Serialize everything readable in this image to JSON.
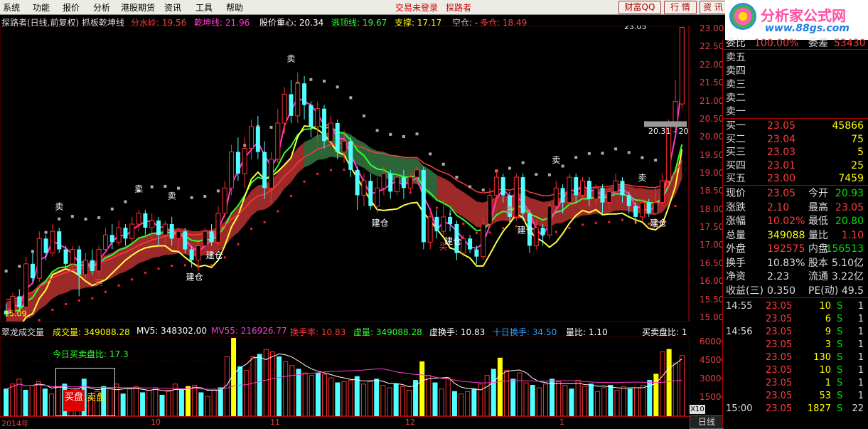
{
  "menu": [
    "系统",
    "功能",
    "报价",
    "分析",
    "港股期货",
    "资讯",
    "工具",
    "帮助"
  ],
  "menu_status": [
    "交易未登录",
    "探路者"
  ],
  "top_buttons": [
    "财富QQ",
    "行 情",
    "资 讯"
  ],
  "logo": {
    "title": "分析家公式网",
    "url": "www.88gs.com"
  },
  "main_indicator": {
    "name": "探路者(日线,前复权) 抓板乾坤线",
    "items": [
      {
        "label": "分水岭: 19.56",
        "color": "#ff3b3b"
      },
      {
        "label": "乾坤线: 21.96",
        "color": "#ff3bd0"
      },
      {
        "label": "股价重心: 20.34",
        "color": "#ffffff"
      },
      {
        "label": "逃顶线: 19.67",
        "color": "#30ff30"
      },
      {
        "label": "支撑: 17.17",
        "color": "#ffff00"
      },
      {
        "label": "空仓: -",
        "color": "#bbbbbb"
      },
      {
        "label": "多仓: 18.49",
        "color": "#ff3b3b"
      }
    ]
  },
  "volume_indicator": {
    "name": "翠龙成交量",
    "items": [
      {
        "label": "成交量: 349088.28",
        "color": "#ffff00"
      },
      {
        "label": "MV5: 348302.00",
        "color": "#ffffff"
      },
      {
        "label": "MV55: 216926.77",
        "color": "#ff3bd0"
      },
      {
        "label": "换手率: 10.83",
        "color": "#ff3b3b"
      },
      {
        "label": "虚量: 349088.28",
        "color": "#30ff30"
      },
      {
        "label": "虚换手: 10.83",
        "color": "#ffffff"
      },
      {
        "label": "十日换手: 34.50",
        "color": "#30a0ff"
      },
      {
        "label": "量比: 1.10",
        "color": "#ffffff"
      },
      {
        "label": "买卖盘比: 1",
        "color": "#ffffff"
      }
    ],
    "today_ratio": "今日买卖盘比: 17.3",
    "buy_label": "买盘",
    "sell_label": "卖盘"
  },
  "price_axis": [
    "23.00",
    "22.50",
    "22.00",
    "21.50",
    "21.00",
    "20.50",
    "20.00",
    "19.50",
    "19.00",
    "18.50",
    "18.00",
    "17.50",
    "17.00",
    "16.50",
    "16.00",
    "15.50",
    "15.00"
  ],
  "volume_axis": [
    "60000",
    "45000",
    "30000",
    "15000"
  ],
  "x_labels": [
    "2014年",
    "10",
    "11",
    "12",
    "1"
  ],
  "annotations": {
    "high_label": "23.05",
    "low_label": "15.09",
    "range_label": "20.31 - 20"
  },
  "signals": {
    "buy": "买",
    "sell": "卖",
    "build": "建仓"
  },
  "order_book": {
    "header": {
      "k1": "委比",
      "v1": "100.00%",
      "k2": "委差",
      "v2": "53430"
    },
    "sells": [
      {
        "k": "卖五"
      },
      {
        "k": "卖四"
      },
      {
        "k": "卖三"
      },
      {
        "k": "卖二"
      },
      {
        "k": "卖一"
      }
    ],
    "buys": [
      {
        "k": "买一",
        "p": "23.05",
        "v": "45866"
      },
      {
        "k": "买二",
        "p": "23.04",
        "v": "75"
      },
      {
        "k": "买三",
        "p": "23.03",
        "v": "5"
      },
      {
        "k": "买四",
        "p": "23.01",
        "v": "25"
      },
      {
        "k": "买五",
        "p": "23.00",
        "v": "7459"
      }
    ]
  },
  "quote": [
    {
      "k1": "现价",
      "v1": "23.05",
      "c1": "red",
      "k2": "今开",
      "v2": "20.93",
      "c2": "green"
    },
    {
      "k1": "涨跌",
      "v1": "2.10",
      "c1": "red",
      "k2": "最高",
      "v2": "23.05",
      "c2": "red"
    },
    {
      "k1": "涨幅",
      "v1": "10.02%",
      "c1": "red",
      "k2": "最低",
      "v2": "20.80",
      "c2": "green"
    },
    {
      "k1": "总量",
      "v1": "349088",
      "c1": "yellow",
      "k2": "量比",
      "v2": "1.10",
      "c2": "red"
    },
    {
      "k1": "外盘",
      "v1": "192575",
      "c1": "red",
      "k2": "内盘",
      "v2": "156513",
      "c2": "green"
    },
    {
      "k1": "换手",
      "v1": "10.83%",
      "c1": "wht",
      "k2": "股本",
      "v2": "5.10亿",
      "c2": "wht"
    },
    {
      "k1": "净资",
      "v1": "2.23",
      "c1": "wht",
      "k2": "流通",
      "v2": "3.22亿",
      "c2": "wht"
    },
    {
      "k1": "收益(三)",
      "v1": "0.350",
      "c1": "wht",
      "k2": "PE(动)",
      "v2": "49.5",
      "c2": "wht"
    }
  ],
  "ticks": [
    {
      "t": "14:55",
      "p": "23.05",
      "v": "10",
      "s": "S",
      "n": "1"
    },
    {
      "t": "",
      "p": "23.05",
      "v": "6",
      "s": "S",
      "n": "1"
    },
    {
      "t": "14:56",
      "p": "23.05",
      "v": "9",
      "s": "S",
      "n": "1"
    },
    {
      "t": "",
      "p": "23.05",
      "v": "3",
      "s": "S",
      "n": "1"
    },
    {
      "t": "",
      "p": "23.05",
      "v": "130",
      "s": "S",
      "n": "1"
    },
    {
      "t": "",
      "p": "23.05",
      "v": "10",
      "s": "S",
      "n": "1"
    },
    {
      "t": "",
      "p": "23.05",
      "v": "1",
      "s": "S",
      "n": "1"
    },
    {
      "t": "",
      "p": "23.05",
      "v": "53",
      "s": "S",
      "n": "1"
    },
    {
      "t": "15:00",
      "p": "23.05",
      "v": "1827",
      "s": "S",
      "n": "22"
    }
  ],
  "tabs": {
    "day": "日线",
    "x10": "X10"
  },
  "chart_data": [
    {
      "type": "candlestick",
      "title": "探路者(日线,前复权) 抓板乾坤线",
      "ylim": [
        15.0,
        23.05
      ],
      "x_tick_labels": [
        "2014年",
        "10",
        "11",
        "12",
        "1"
      ],
      "candles": [
        {
          "o": 15.2,
          "c": 15.1,
          "h": 15.4,
          "l": 15.09
        },
        {
          "o": 15.1,
          "c": 15.6,
          "h": 15.7,
          "l": 15.05
        },
        {
          "o": 15.6,
          "c": 15.3,
          "h": 15.8,
          "l": 15.2
        },
        {
          "o": 15.3,
          "c": 16.5,
          "h": 16.7,
          "l": 15.2
        },
        {
          "o": 16.5,
          "c": 16.1,
          "h": 16.8,
          "l": 16.0
        },
        {
          "o": 16.1,
          "c": 17.2,
          "h": 17.4,
          "l": 16.0
        },
        {
          "o": 17.2,
          "c": 16.8,
          "h": 17.3,
          "l": 16.6
        },
        {
          "o": 16.8,
          "c": 17.4,
          "h": 17.6,
          "l": 16.7
        },
        {
          "o": 17.4,
          "c": 16.9,
          "h": 17.5,
          "l": 16.8
        },
        {
          "o": 16.9,
          "c": 16.5,
          "h": 17.0,
          "l": 16.4
        },
        {
          "o": 16.5,
          "c": 16.9,
          "h": 17.0,
          "l": 16.3
        },
        {
          "o": 16.9,
          "c": 16.2,
          "h": 17.0,
          "l": 15.6
        },
        {
          "o": 16.2,
          "c": 16.6,
          "h": 16.8,
          "l": 16.1
        },
        {
          "o": 16.6,
          "c": 16.3,
          "h": 16.9,
          "l": 16.2
        },
        {
          "o": 16.3,
          "c": 16.9,
          "h": 17.0,
          "l": 16.2
        },
        {
          "o": 16.9,
          "c": 17.3,
          "h": 17.5,
          "l": 16.8
        },
        {
          "o": 17.3,
          "c": 17.1,
          "h": 17.6,
          "l": 16.9
        },
        {
          "o": 17.1,
          "c": 17.5,
          "h": 17.7,
          "l": 17.0
        },
        {
          "o": 17.5,
          "c": 17.2,
          "h": 17.6,
          "l": 17.0
        },
        {
          "o": 17.2,
          "c": 17.6,
          "h": 17.8,
          "l": 17.1
        },
        {
          "o": 17.6,
          "c": 17.9,
          "h": 18.0,
          "l": 17.4
        },
        {
          "o": 17.9,
          "c": 17.5,
          "h": 18.0,
          "l": 17.3
        },
        {
          "o": 17.5,
          "c": 17.7,
          "h": 17.9,
          "l": 17.2
        },
        {
          "o": 17.7,
          "c": 17.3,
          "h": 17.8,
          "l": 17.0
        },
        {
          "o": 17.3,
          "c": 17.6,
          "h": 17.7,
          "l": 17.1
        },
        {
          "o": 17.6,
          "c": 17.2,
          "h": 17.8,
          "l": 17.0
        },
        {
          "o": 17.2,
          "c": 17.4,
          "h": 17.5,
          "l": 16.9
        },
        {
          "o": 17.4,
          "c": 16.9,
          "h": 17.5,
          "l": 16.8
        },
        {
          "o": 16.9,
          "c": 16.6,
          "h": 17.0,
          "l": 16.4
        },
        {
          "o": 16.6,
          "c": 17.0,
          "h": 17.1,
          "l": 16.3
        },
        {
          "o": 17.0,
          "c": 17.4,
          "h": 17.5,
          "l": 16.9
        },
        {
          "o": 17.4,
          "c": 17.1,
          "h": 17.6,
          "l": 17.0
        },
        {
          "o": 17.1,
          "c": 17.9,
          "h": 18.1,
          "l": 17.0
        },
        {
          "o": 17.9,
          "c": 18.6,
          "h": 18.8,
          "l": 17.8
        },
        {
          "o": 18.6,
          "c": 19.6,
          "h": 19.8,
          "l": 18.4
        },
        {
          "o": 19.6,
          "c": 19.0,
          "h": 20.0,
          "l": 18.8
        },
        {
          "o": 19.0,
          "c": 19.7,
          "h": 20.0,
          "l": 18.6
        },
        {
          "o": 19.7,
          "c": 20.3,
          "h": 20.5,
          "l": 19.4
        },
        {
          "o": 20.3,
          "c": 19.6,
          "h": 20.6,
          "l": 19.4
        },
        {
          "o": 19.6,
          "c": 18.6,
          "h": 19.9,
          "l": 18.3
        },
        {
          "o": 18.6,
          "c": 19.4,
          "h": 19.6,
          "l": 18.2
        },
        {
          "o": 19.4,
          "c": 20.4,
          "h": 20.8,
          "l": 19.3
        },
        {
          "o": 20.4,
          "c": 21.2,
          "h": 21.4,
          "l": 20.1
        },
        {
          "o": 21.2,
          "c": 20.6,
          "h": 21.6,
          "l": 20.4
        },
        {
          "o": 20.6,
          "c": 21.5,
          "h": 21.8,
          "l": 20.4
        },
        {
          "o": 21.5,
          "c": 20.9,
          "h": 21.7,
          "l": 20.5
        },
        {
          "o": 20.9,
          "c": 20.3,
          "h": 21.0,
          "l": 20.0
        },
        {
          "o": 20.3,
          "c": 20.8,
          "h": 21.0,
          "l": 19.9
        },
        {
          "o": 20.8,
          "c": 19.9,
          "h": 20.9,
          "l": 19.7
        },
        {
          "o": 19.9,
          "c": 20.4,
          "h": 20.6,
          "l": 19.8
        },
        {
          "o": 20.4,
          "c": 19.6,
          "h": 20.5,
          "l": 19.4
        },
        {
          "o": 19.6,
          "c": 19.9,
          "h": 20.2,
          "l": 19.3
        },
        {
          "o": 19.9,
          "c": 19.1,
          "h": 20.0,
          "l": 18.9
        },
        {
          "o": 19.1,
          "c": 18.4,
          "h": 19.2,
          "l": 18.0
        },
        {
          "o": 18.4,
          "c": 18.8,
          "h": 19.0,
          "l": 18.1
        },
        {
          "o": 18.8,
          "c": 18.1,
          "h": 19.0,
          "l": 18.0
        },
        {
          "o": 18.1,
          "c": 18.6,
          "h": 18.9,
          "l": 17.9
        },
        {
          "o": 18.6,
          "c": 19.0,
          "h": 19.2,
          "l": 18.4
        },
        {
          "o": 19.0,
          "c": 18.5,
          "h": 19.1,
          "l": 18.3
        },
        {
          "o": 18.5,
          "c": 18.9,
          "h": 19.0,
          "l": 18.4
        },
        {
          "o": 18.9,
          "c": 18.6,
          "h": 19.1,
          "l": 18.3
        },
        {
          "o": 18.6,
          "c": 18.9,
          "h": 19.0,
          "l": 18.5
        },
        {
          "o": 18.9,
          "c": 19.1,
          "h": 19.2,
          "l": 18.7
        },
        {
          "o": 19.1,
          "c": 17.1,
          "h": 19.2,
          "l": 16.9
        },
        {
          "o": 17.1,
          "c": 17.8,
          "h": 18.0,
          "l": 16.9
        },
        {
          "o": 17.8,
          "c": 17.4,
          "h": 18.0,
          "l": 17.2
        },
        {
          "o": 17.4,
          "c": 17.8,
          "h": 18.3,
          "l": 17.3
        },
        {
          "o": 17.8,
          "c": 17.6,
          "h": 18.0,
          "l": 17.4
        },
        {
          "o": 17.6,
          "c": 16.8,
          "h": 17.7,
          "l": 16.6
        },
        {
          "o": 16.8,
          "c": 17.2,
          "h": 17.3,
          "l": 16.7
        },
        {
          "o": 17.2,
          "c": 16.9,
          "h": 17.3,
          "l": 16.8
        },
        {
          "o": 16.9,
          "c": 16.7,
          "h": 17.0,
          "l": 16.5
        },
        {
          "o": 16.7,
          "c": 17.6,
          "h": 17.8,
          "l": 16.6
        },
        {
          "o": 17.6,
          "c": 18.4,
          "h": 18.6,
          "l": 17.5
        },
        {
          "o": 18.4,
          "c": 18.9,
          "h": 19.1,
          "l": 18.2
        },
        {
          "o": 18.9,
          "c": 18.4,
          "h": 19.0,
          "l": 18.2
        },
        {
          "o": 18.4,
          "c": 17.8,
          "h": 18.5,
          "l": 17.6
        },
        {
          "o": 17.8,
          "c": 18.9,
          "h": 19.0,
          "l": 17.7
        },
        {
          "o": 18.9,
          "c": 17.9,
          "h": 19.0,
          "l": 17.7
        },
        {
          "o": 17.9,
          "c": 17.0,
          "h": 18.0,
          "l": 16.8
        },
        {
          "o": 17.0,
          "c": 17.5,
          "h": 17.7,
          "l": 16.9
        },
        {
          "o": 17.5,
          "c": 17.3,
          "h": 17.6,
          "l": 17.0
        },
        {
          "o": 17.3,
          "c": 18.1,
          "h": 18.2,
          "l": 17.2
        },
        {
          "o": 18.1,
          "c": 18.6,
          "h": 18.8,
          "l": 18.0
        },
        {
          "o": 18.6,
          "c": 18.2,
          "h": 18.7,
          "l": 17.9
        },
        {
          "o": 18.2,
          "c": 18.9,
          "h": 19.0,
          "l": 18.1
        },
        {
          "o": 18.9,
          "c": 18.4,
          "h": 19.0,
          "l": 18.2
        },
        {
          "o": 18.4,
          "c": 18.8,
          "h": 18.9,
          "l": 18.3
        },
        {
          "o": 18.8,
          "c": 18.3,
          "h": 18.9,
          "l": 18.1
        },
        {
          "o": 18.3,
          "c": 18.6,
          "h": 18.7,
          "l": 18.1
        },
        {
          "o": 18.6,
          "c": 18.2,
          "h": 18.7,
          "l": 17.9
        },
        {
          "o": 18.2,
          "c": 18.5,
          "h": 18.6,
          "l": 18.0
        },
        {
          "o": 18.5,
          "c": 18.8,
          "h": 19.0,
          "l": 18.4
        },
        {
          "o": 18.8,
          "c": 18.4,
          "h": 18.9,
          "l": 18.2
        },
        {
          "o": 18.4,
          "c": 18.1,
          "h": 18.5,
          "l": 17.9
        },
        {
          "o": 18.1,
          "c": 17.8,
          "h": 18.2,
          "l": 17.6
        },
        {
          "o": 17.8,
          "c": 18.2,
          "h": 18.3,
          "l": 17.7
        },
        {
          "o": 18.2,
          "c": 17.9,
          "h": 18.3,
          "l": 17.8
        },
        {
          "o": 17.9,
          "c": 18.2,
          "h": 18.6,
          "l": 17.9
        },
        {
          "o": 18.2,
          "c": 18.8,
          "h": 19.0,
          "l": 18.1
        },
        {
          "o": 18.8,
          "c": 20.3,
          "h": 20.5,
          "l": 18.6
        },
        {
          "o": 20.3,
          "c": 21.0,
          "h": 21.6,
          "l": 20.2
        },
        {
          "o": 20.93,
          "c": 23.05,
          "h": 23.05,
          "l": 20.8
        }
      ],
      "lines": [
        {
          "name": "分水岭",
          "color": "#ff3b3b",
          "last": 19.56
        },
        {
          "name": "乾坤线",
          "color": "#ff3bd0",
          "last": 21.96
        },
        {
          "name": "逃顶线",
          "color": "#30ff30",
          "last": 19.67
        },
        {
          "name": "支撑",
          "color": "#ffff00",
          "last": 17.17
        }
      ]
    },
    {
      "type": "bar",
      "title": "翠龙成交量",
      "ylim": [
        0,
        65000
      ],
      "values": [
        22000,
        26000,
        30000,
        21000,
        25000,
        28000,
        22000,
        18000,
        24000,
        26000,
        20000,
        22000,
        30000,
        15000,
        20000,
        24000,
        22000,
        26000,
        18000,
        22000,
        24000,
        19000,
        21000,
        23000,
        17000,
        21000,
        26000,
        21000,
        24000,
        25000,
        19000,
        16000,
        21000,
        23000,
        48000,
        63000,
        40000,
        37000,
        48000,
        50000,
        54000,
        52000,
        48000,
        44000,
        41000,
        38000,
        35000,
        33000,
        35000,
        34000,
        31000,
        27000,
        28000,
        29000,
        32000,
        26000,
        28000,
        30000,
        25000,
        23000,
        26000,
        24000,
        21000,
        29000,
        44000,
        33000,
        27000,
        22000,
        31000,
        20000,
        18000,
        20000,
        22000,
        26000,
        33000,
        38000,
        47000,
        37000,
        30000,
        35000,
        27000,
        25000,
        23000,
        26000,
        30000,
        28000,
        25000,
        22000,
        29000,
        24000,
        26000,
        20000,
        23000,
        25000,
        21000,
        24000,
        22000,
        23000,
        25000,
        29000,
        34000,
        52000,
        54000,
        43000,
        49000
      ],
      "highlight_indices": [
        28,
        35,
        64,
        76,
        100,
        102
      ]
    }
  ]
}
